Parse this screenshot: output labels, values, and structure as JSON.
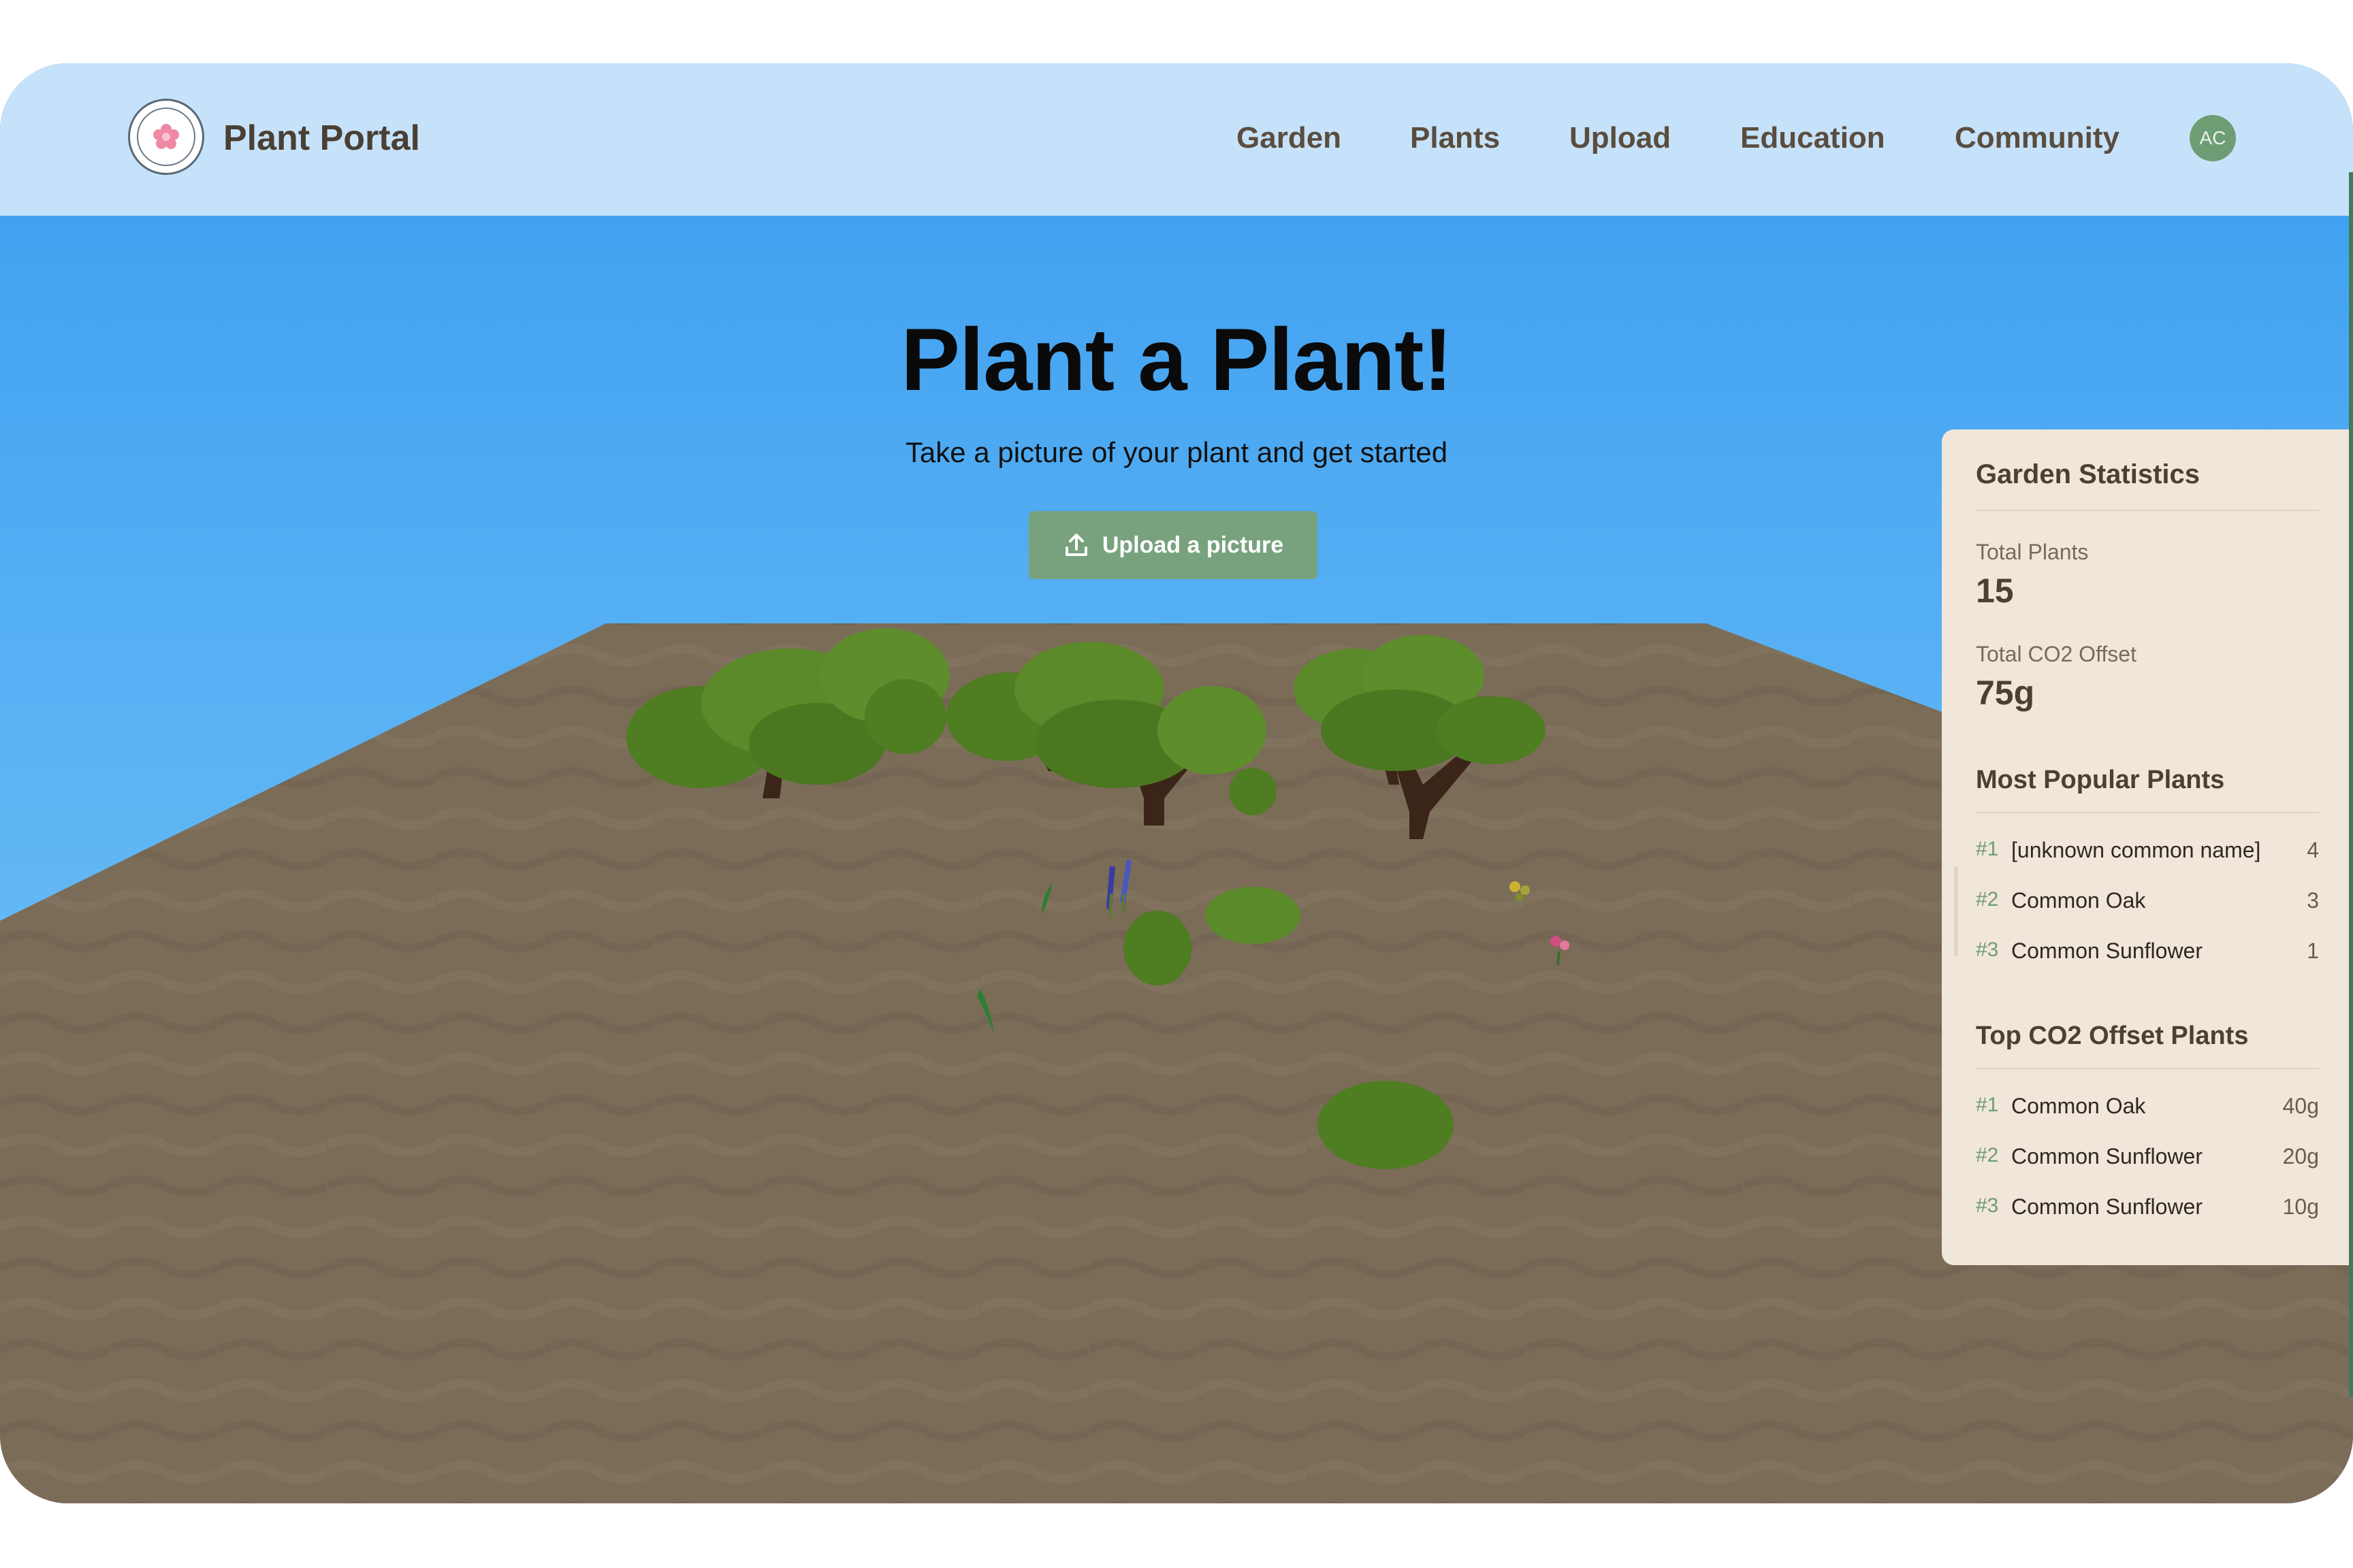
{
  "nav": {
    "brand": "Plant Portal",
    "links": [
      "Garden",
      "Plants",
      "Upload",
      "Education",
      "Community"
    ],
    "avatar_initials": "AC"
  },
  "hero": {
    "title": "Plant a Plant!",
    "subtitle": "Take a picture of your plant and get started",
    "upload_label": "Upload a picture"
  },
  "stats": {
    "title": "Garden Statistics",
    "total_plants_label": "Total Plants",
    "total_plants_value": "15",
    "total_co2_label": "Total CO2 Offset",
    "total_co2_value": "75g",
    "popular_title": "Most Popular Plants",
    "popular": [
      {
        "rank": "#1",
        "name": "[unknown common name]",
        "value": "4"
      },
      {
        "rank": "#2",
        "name": "Common Oak",
        "value": "3"
      },
      {
        "rank": "#3",
        "name": "Common Sunflower",
        "value": "1"
      }
    ],
    "co2_title": "Top CO2 Offset Plants",
    "co2": [
      {
        "rank": "#1",
        "name": "Common Oak",
        "value": "40g"
      },
      {
        "rank": "#2",
        "name": "Common Sunflower",
        "value": "20g"
      },
      {
        "rank": "#3",
        "name": "Common Sunflower",
        "value": "10g"
      }
    ]
  },
  "colors": {
    "nav_bg": "#c6e2fa",
    "sky_top": "#3fa3f0",
    "ground": "#7b6c58",
    "button": "#78a27d",
    "panel_bg": "#f1e6da",
    "foliage": "#4f7d22"
  },
  "icons": {
    "logo": "flower-badge-icon",
    "upload": "upload-icon"
  }
}
